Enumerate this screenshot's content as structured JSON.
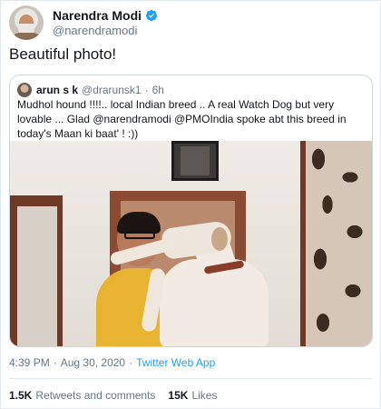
{
  "author": {
    "display_name": "Narendra Modi",
    "handle": "@narendramodi",
    "verified": true
  },
  "tweet": {
    "text": "Beautiful photo!"
  },
  "quoted_tweet": {
    "display_name": "arun s k",
    "handle": "@drarunsk1",
    "separator": "·",
    "time": "6h",
    "text": "Mudhol hound !!!!.. local Indian breed .. A real Watch Dog but very lovable ... Glad @narendramodi @PMOIndia spoke abt this breed in today's Maan ki baat' ! :))"
  },
  "meta": {
    "time": "4:39 PM",
    "separator1": "·",
    "date": "Aug 30, 2020",
    "separator2": "·",
    "source": "Twitter Web App"
  },
  "stats": {
    "retweets_count": "1.5K",
    "retweets_label": "Retweets and comments",
    "likes_count": "15K",
    "likes_label": "Likes"
  },
  "colors": {
    "link": "#1da1f2",
    "verified_badge": "#1da1f2",
    "secondary_text": "#657786"
  }
}
